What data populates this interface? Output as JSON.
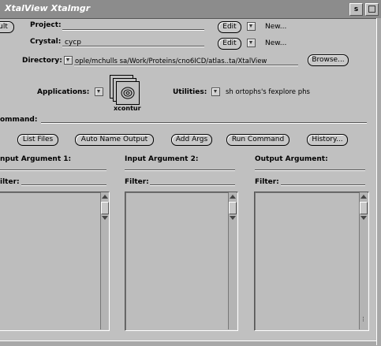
{
  "window": {
    "title": "XtalView  Xtalmgr",
    "menu_button": "s"
  },
  "project": {
    "label": "Project:",
    "value": "",
    "edit": "Edit",
    "new": "New..."
  },
  "crystal": {
    "label": "Crystal:",
    "value": "cycp",
    "edit": "Edit",
    "new": "New..."
  },
  "left_button": "ult",
  "directory": {
    "label": "Directory:",
    "value": "ople/mchulls sa/Work/Proteins/cno6ICD/atlas..ta/XtalView",
    "browse": "Browse..."
  },
  "applications": {
    "label": "Applications:",
    "icon_caption": "xcontur"
  },
  "utilities": {
    "label": "Utilities:",
    "value": "sh ortophs's fexplore phs"
  },
  "command": {
    "label": "ommand:",
    "value": ""
  },
  "buttons": {
    "list_files": "List Files",
    "auto_name": "Auto Name Output",
    "add_args": "Add Args",
    "run": "Run Command",
    "history": "History..."
  },
  "columns": [
    {
      "header": "nput Argument 1:",
      "filter_label": "ilter:"
    },
    {
      "header": "Input Argument 2:",
      "filter_label": "Filter:"
    },
    {
      "header": "Output Argument:",
      "filter_label": "Filter:"
    }
  ]
}
